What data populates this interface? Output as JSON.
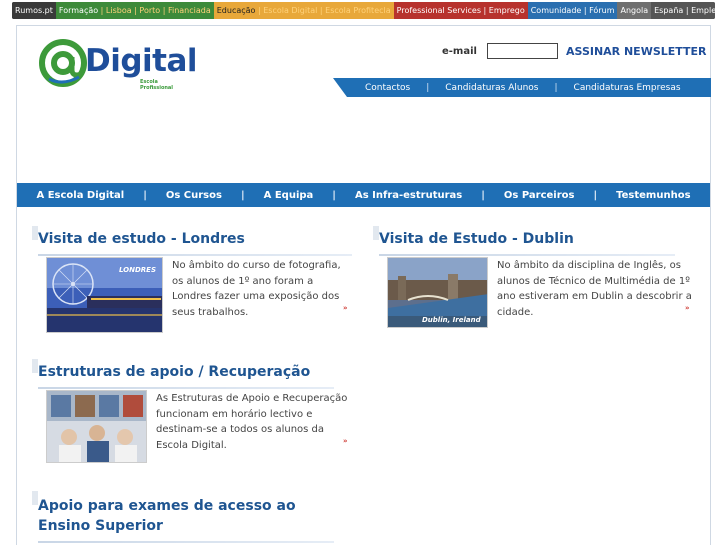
{
  "netbar": {
    "rumos": "Rumos.pt",
    "formacao": "Formação",
    "formacao_sub": " | Lisboa | Porto | Financiada",
    "educacao": "Educação",
    "educacao_sub": " | Escola Digital | Escola Profitecla",
    "professional": "Professional Services | Emprego",
    "comunidade": "Comunidade | Fórum",
    "angola": "Angola",
    "espana": "España | Empleo"
  },
  "logo": {
    "word": "Digital",
    "tagline": "Escola Profissional"
  },
  "newsletter": {
    "email_label": "e-mail",
    "email_value": "",
    "subscribe_label": "ASSINAR NEWSLETTER"
  },
  "topnav": [
    "Contactos",
    "Candidaturas Alunos",
    "Candidaturas Empresas"
  ],
  "topnav_separator": "|",
  "mainnav": [
    "A Escola Digital",
    "Os Cursos",
    "A Equipa",
    "As Infra-estruturas",
    "Os Parceiros",
    "Testemunhos"
  ],
  "mainnav_separator": "|",
  "articles": [
    {
      "title": "Visita de estudo - Londres",
      "text": "No âmbito do curso de fotografia, os alunos de 1º ano foram a Londres fazer uma exposição dos seus trabalhos.",
      "more": "»",
      "image_caption": "LONDRES"
    },
    {
      "title": "Visita de Estudo - Dublin",
      "text": "No âmbito da disciplina de Inglês, os alunos de Técnico de Multimédia de 1º ano estiveram em Dublin a descobrir a cidade.",
      "more": "»",
      "image_caption": "Dublin, Ireland"
    },
    {
      "title": "Estruturas de apoio / Recuperação",
      "text": "As Estruturas de Apoio e Recuperação funcionam em horário lectivo e destinam-se a todos os alunos da Escola Digital.",
      "more": "»",
      "image_caption": ""
    },
    {
      "title": "Apoio para exames de acesso ao Ensino Superior",
      "text": "",
      "more": "",
      "image_caption": ""
    }
  ],
  "colors": {
    "brand_blue": "#1f6fb5",
    "title_blue": "#1f5591",
    "more_red": "#d0403a",
    "logo_green": "#3d9a3a"
  }
}
